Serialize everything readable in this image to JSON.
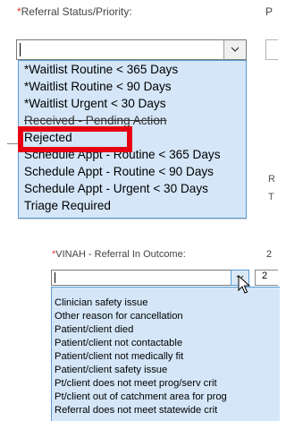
{
  "referral_panel": {
    "field_label": "*Referral Status/Priority:",
    "clipped_right_label": "P",
    "combo_value": "",
    "options": [
      "*Waitlist Routine < 365 Days",
      "*Waitlist Routine < 90 Days",
      "*Waitlist Urgent < 30 Days",
      "Received - Pending Action",
      "Rejected",
      "Schedule Appt - Routine < 365 Days",
      "Schedule Appt - Routine < 90 Days",
      "Schedule Appt - Urgent < 30 Days",
      "Triage Required"
    ],
    "highlighted_option": "Rejected",
    "highlight_color": "#e60012",
    "right_fragments": [
      "R",
      "T"
    ]
  },
  "outcome_panel": {
    "field_label": "*VINAH - Referral In Outcome:",
    "clipped_right_label": "2",
    "combo_value": "",
    "right_field_value": "2",
    "options": [
      "Clinician safety issue",
      "Other reason for cancellation",
      "Patient/client died",
      "Patient/client not contactable",
      "Patient/client not medically fit",
      "Patient/client safety issue",
      "Pt/client does not meet prog/serv crit",
      "Pt/client out of catchment area for prog",
      "Referral does not meet statewide crit"
    ]
  },
  "colors": {
    "dropdown_bg": "#d4e6f8",
    "dropdown_border": "#5b9bd5",
    "required_star": "#e8322a"
  },
  "icons": [
    "chevron-down-icon",
    "mouse-pointer-icon"
  ]
}
